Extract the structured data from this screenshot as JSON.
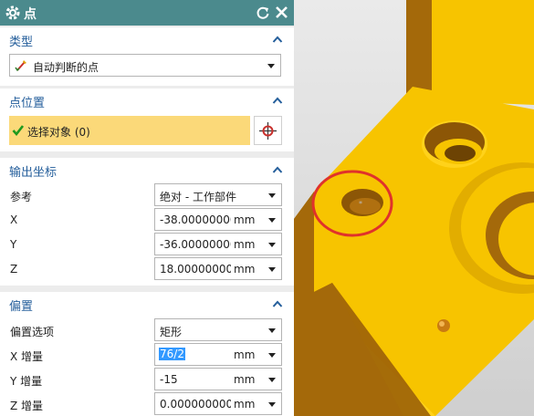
{
  "dialog": {
    "title": "点",
    "icons": {
      "settings": "gear-icon",
      "reset": "reset-icon",
      "close": "close-icon"
    }
  },
  "type_section": {
    "title": "类型",
    "selected": "自动判断的点",
    "icon": "inferred-point-icon"
  },
  "point_location": {
    "title": "点位置",
    "select_object": "选择对象 (0)",
    "check_icon": "check-icon",
    "point_icon": "point-crosshair-icon"
  },
  "output_coords": {
    "title": "输出坐标",
    "reference_label": "参考",
    "reference_value": "绝对 - 工作部件",
    "x_label": "X",
    "x_value": "-38.0000000000",
    "y_label": "Y",
    "y_value": "-36.0000000000",
    "z_label": "Z",
    "z_value": "18.0000000000",
    "unit": "mm"
  },
  "offset": {
    "title": "偏置",
    "option_label": "偏置选项",
    "option_value": "矩形",
    "dx_label": "X 增量",
    "dx_value": "76/2",
    "dy_label": "Y 增量",
    "dy_value": "-15",
    "dz_label": "Z 增量",
    "dz_value": "0.0000000000",
    "unit": "mm"
  },
  "colors": {
    "title_bar": "#4b8a8d",
    "section_title": "#245e9b",
    "selection_highlight": "#fbd979",
    "part_face": "#f7c400",
    "part_side": "#a4690a",
    "annotation_circle": "#e0322b"
  }
}
